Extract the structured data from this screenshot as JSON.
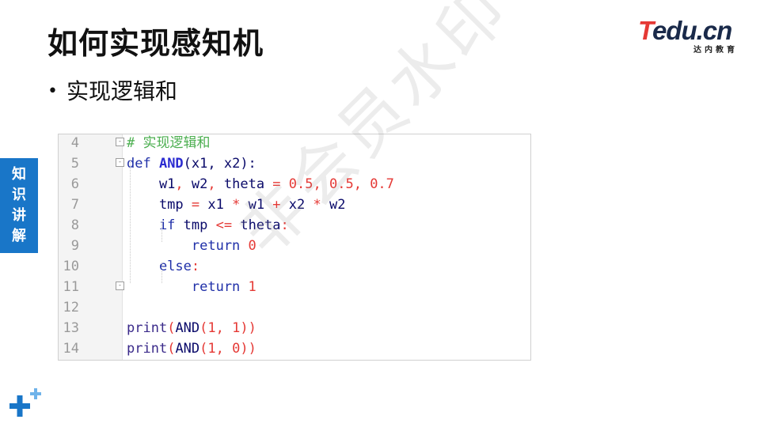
{
  "slide": {
    "title": "如何实现感知机",
    "bullet": "实现逻辑和",
    "side_tab": "知识讲解",
    "watermark": "非会员水印"
  },
  "logo": {
    "brand_t": "T",
    "brand_rest": "edu.cn",
    "sub": "达内教育"
  },
  "code": {
    "lines": [
      {
        "n": "4",
        "fold": "-",
        "tokens": [
          {
            "t": "# 实现逻辑和",
            "c": "c-comment"
          }
        ]
      },
      {
        "n": "5",
        "fold": "-",
        "tokens": [
          {
            "t": "def ",
            "c": "c-kw"
          },
          {
            "t": "AND",
            "c": "c-fn"
          },
          {
            "t": "(x1, x2):",
            "c": "c-id"
          }
        ]
      },
      {
        "n": "6",
        "fold": "",
        "tokens": [
          {
            "t": "    w1",
            "c": "c-id"
          },
          {
            "t": ", ",
            "c": "c-op"
          },
          {
            "t": "w2",
            "c": "c-id"
          },
          {
            "t": ", ",
            "c": "c-op"
          },
          {
            "t": "theta ",
            "c": "c-id"
          },
          {
            "t": "= ",
            "c": "c-op"
          },
          {
            "t": "0.5",
            "c": "c-num"
          },
          {
            "t": ", ",
            "c": "c-op"
          },
          {
            "t": "0.5",
            "c": "c-num"
          },
          {
            "t": ", ",
            "c": "c-op"
          },
          {
            "t": "0.7",
            "c": "c-num"
          }
        ]
      },
      {
        "n": "7",
        "fold": "",
        "tokens": [
          {
            "t": "    tmp ",
            "c": "c-id"
          },
          {
            "t": "= ",
            "c": "c-op"
          },
          {
            "t": "x1 ",
            "c": "c-id"
          },
          {
            "t": "* ",
            "c": "c-op"
          },
          {
            "t": "w1 ",
            "c": "c-id"
          },
          {
            "t": "+ ",
            "c": "c-op"
          },
          {
            "t": "x2 ",
            "c": "c-id"
          },
          {
            "t": "* ",
            "c": "c-op"
          },
          {
            "t": "w2",
            "c": "c-id"
          }
        ]
      },
      {
        "n": "8",
        "fold": "",
        "tokens": [
          {
            "t": "    if ",
            "c": "c-kw"
          },
          {
            "t": "tmp ",
            "c": "c-id"
          },
          {
            "t": "<= ",
            "c": "c-op"
          },
          {
            "t": "theta",
            "c": "c-id"
          },
          {
            "t": ":",
            "c": "c-op"
          }
        ]
      },
      {
        "n": "9",
        "fold": "",
        "tokens": [
          {
            "t": "        return ",
            "c": "c-kw"
          },
          {
            "t": "0",
            "c": "c-num"
          }
        ]
      },
      {
        "n": "10",
        "fold": "",
        "tokens": [
          {
            "t": "    else",
            "c": "c-kw"
          },
          {
            "t": ":",
            "c": "c-op"
          }
        ]
      },
      {
        "n": "11",
        "fold": "-",
        "tokens": [
          {
            "t": "        return ",
            "c": "c-kw"
          },
          {
            "t": "1",
            "c": "c-num"
          }
        ]
      },
      {
        "n": "12",
        "fold": "",
        "tokens": []
      },
      {
        "n": "13",
        "fold": "",
        "tokens": [
          {
            "t": "print",
            "c": "c-bi"
          },
          {
            "t": "(",
            "c": "c-op"
          },
          {
            "t": "AND",
            "c": "c-id"
          },
          {
            "t": "(",
            "c": "c-op"
          },
          {
            "t": "1",
            "c": "c-num"
          },
          {
            "t": ", ",
            "c": "c-op"
          },
          {
            "t": "1",
            "c": "c-num"
          },
          {
            "t": "))",
            "c": "c-op"
          }
        ]
      },
      {
        "n": "14",
        "fold": "",
        "tokens": [
          {
            "t": "print",
            "c": "c-bi"
          },
          {
            "t": "(",
            "c": "c-op"
          },
          {
            "t": "AND",
            "c": "c-id"
          },
          {
            "t": "(",
            "c": "c-op"
          },
          {
            "t": "1",
            "c": "c-num"
          },
          {
            "t": ", ",
            "c": "c-op"
          },
          {
            "t": "0",
            "c": "c-num"
          },
          {
            "t": "))",
            "c": "c-op"
          }
        ]
      }
    ]
  },
  "colors": {
    "accent_blue": "#1976c8",
    "logo_red": "#e53935",
    "plus_blue": "#1976c8",
    "plus_light": "#6fb3ea"
  }
}
